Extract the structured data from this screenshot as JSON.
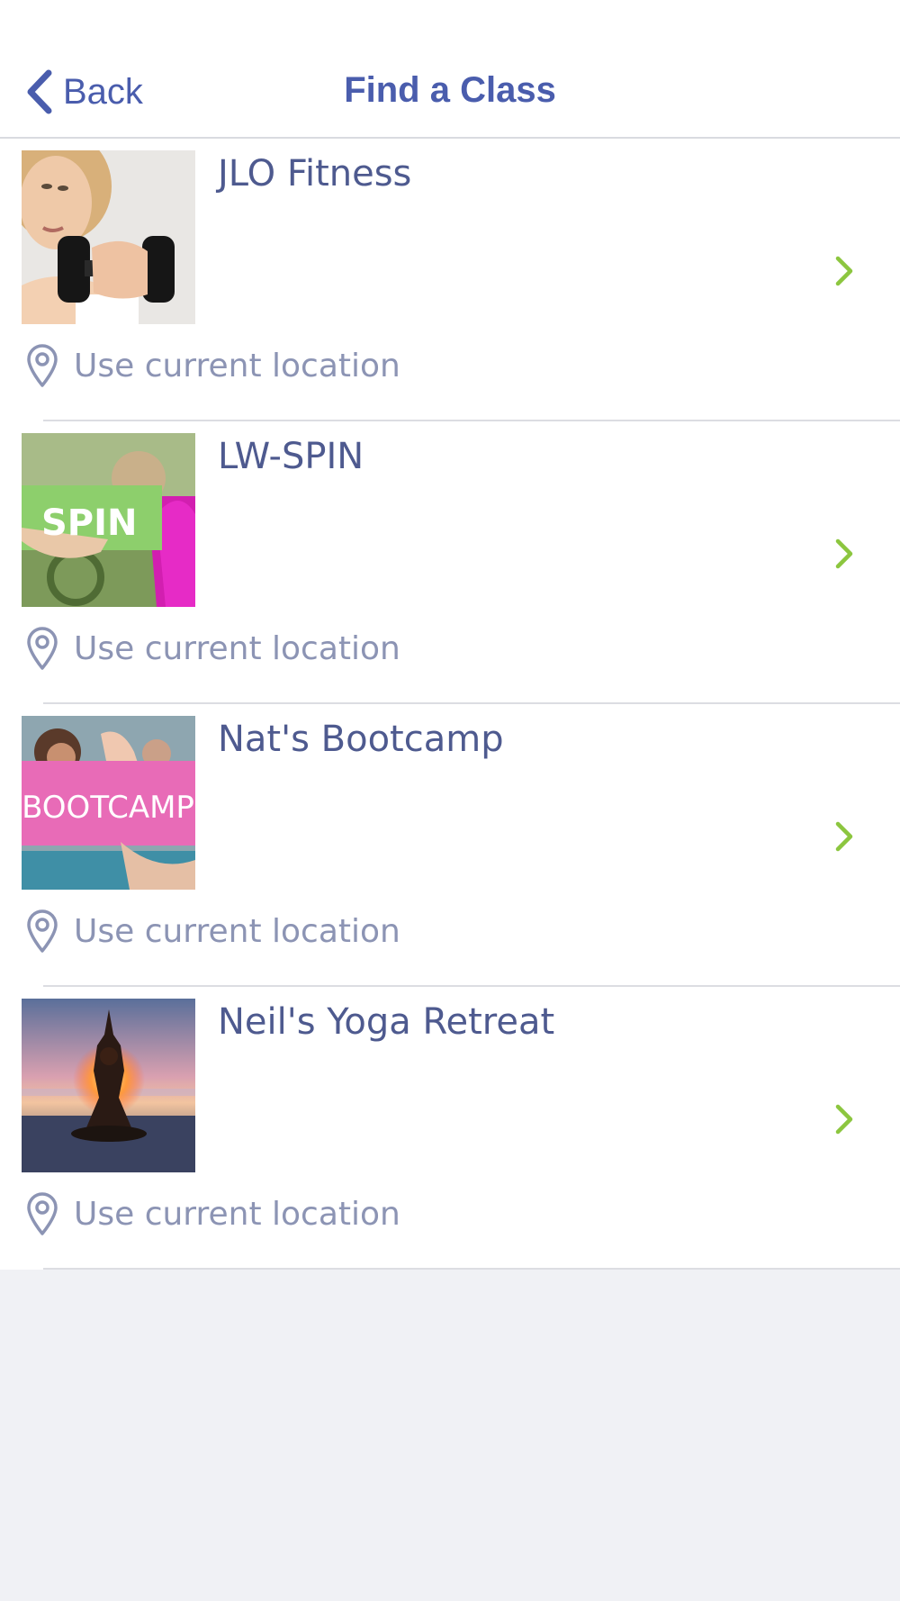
{
  "nav": {
    "back_label": "Back",
    "back_icon": "chevron-left-icon",
    "title": "Find a Class"
  },
  "colors": {
    "accent": "#4a5dad",
    "chevron": "#8cc63f",
    "secondary_text": "#8c94b4",
    "background": "#f0f1f5"
  },
  "classes": [
    {
      "name": "JLO Fitness",
      "location": "Use current location",
      "image": "woman holding dumbbell photo"
    },
    {
      "name": "LW-SPIN",
      "location": "Use current location",
      "image": "hand holding SPIN sign photo",
      "image_text": "SPIN"
    },
    {
      "name": "Nat's Bootcamp",
      "location": "Use current location",
      "image": "hand holding BOOTCAMP sign photo",
      "image_text": "BOOTCAMP"
    },
    {
      "name": "Neil's Yoga Retreat",
      "location": "Use current location",
      "image": "yoga silhouette at sunset photo"
    }
  ]
}
